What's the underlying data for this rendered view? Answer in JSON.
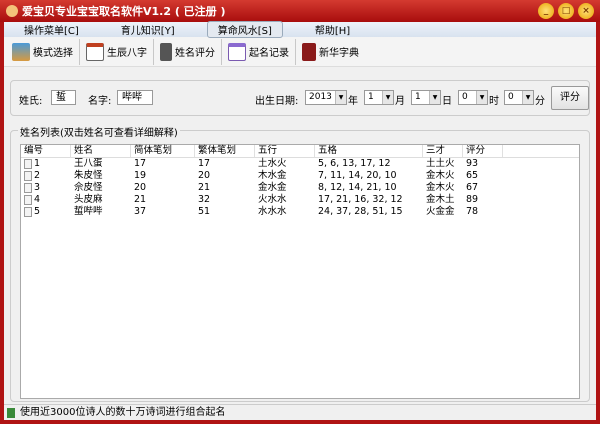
{
  "title": "爱宝贝专业宝宝取名软件V1.2 ( 已注册 )",
  "window_buttons": [
    "minimize",
    "maximize",
    "close"
  ],
  "menu": [
    "操作菜单[C]",
    "育儿知识[Y]",
    "算命风水[S]",
    "帮助[H]"
  ],
  "toolbar": [
    "模式选择",
    "生辰八字",
    "姓名评分",
    "起名记录",
    "新华字典"
  ],
  "form": {
    "surname_label": "姓氏:",
    "surname": "蜇",
    "name_label": "名字:",
    "name": "哔哔",
    "birth_label": "出生日期:",
    "year": "2013",
    "year_unit": "年",
    "month": "1",
    "month_unit": "月",
    "day": "1",
    "day_unit": "日",
    "hour": "0",
    "hour_unit": "时",
    "minute": "0",
    "minute_unit": "分",
    "score_button": "评分"
  },
  "list": {
    "title": "姓名列表(双击姓名可查看详细解释)",
    "columns": [
      "编号",
      "姓名",
      "简体笔划",
      "繁体笔划",
      "五行",
      "五格",
      "三才",
      "评分"
    ],
    "rows": [
      [
        "1",
        "王八蛋",
        "17",
        "17",
        "土水火",
        "5, 6, 13, 17, 12",
        "土土火",
        "93"
      ],
      [
        "2",
        "朱皮怪",
        "19",
        "20",
        "木水金",
        "7, 11, 14, 20, 10",
        "金木火",
        "65"
      ],
      [
        "3",
        "佘皮怪",
        "20",
        "21",
        "金水金",
        "8, 12, 14, 21, 10",
        "金木火",
        "67"
      ],
      [
        "4",
        "头皮麻",
        "21",
        "32",
        "火水水",
        "17, 21, 16, 32, 12",
        "金木土",
        "89"
      ],
      [
        "5",
        "蜇哔哔",
        "37",
        "51",
        "水水水",
        "24, 37, 28, 51, 15",
        "火金金",
        "78"
      ]
    ]
  },
  "status": "使用近3000位诗人的数十万诗词进行组合起名"
}
